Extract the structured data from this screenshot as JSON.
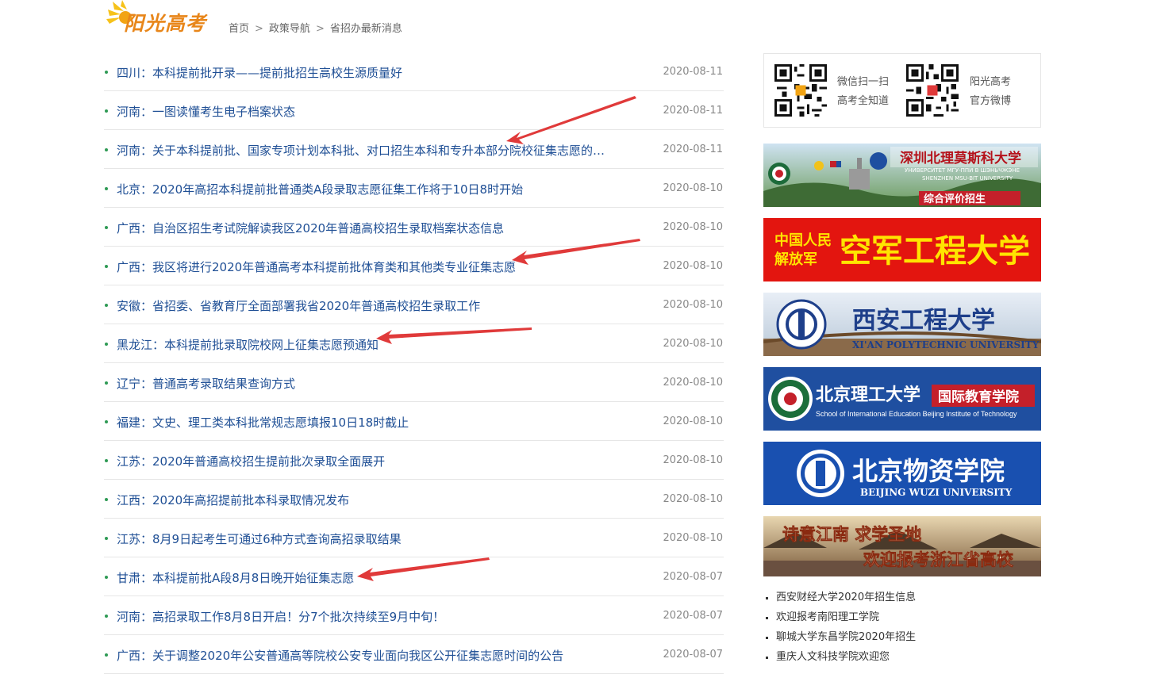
{
  "header": {
    "logo_text": "阳光高考",
    "breadcrumb": [
      "首页",
      "政策导航",
      "省招办最新消息"
    ],
    "breadcrumb_sep": ">"
  },
  "news": [
    {
      "title": "四川：本科提前批开录——提前批招生高校生源质量好",
      "date": "2020-08-11"
    },
    {
      "title": "河南：一图读懂考生电子档案状态",
      "date": "2020-08-11"
    },
    {
      "title": "河南：关于本科提前批、国家专项计划本科批、对口招生本科和专升本部分院校征集志愿的公告",
      "date": "2020-08-11"
    },
    {
      "title": "北京：2020年高招本科提前批普通类A段录取志愿征集工作将于10日8时开始",
      "date": "2020-08-10"
    },
    {
      "title": "广西：自治区招生考试院解读我区2020年普通高校招生录取档案状态信息",
      "date": "2020-08-10"
    },
    {
      "title": "广西：我区将进行2020年普通高考本科提前批体育类和其他类专业征集志愿",
      "date": "2020-08-10"
    },
    {
      "title": "安徽：省招委、省教育厅全面部署我省2020年普通高校招生录取工作",
      "date": "2020-08-10"
    },
    {
      "title": "黑龙江：本科提前批录取院校网上征集志愿预通知",
      "date": "2020-08-10"
    },
    {
      "title": "辽宁：普通高考录取结果查询方式",
      "date": "2020-08-10"
    },
    {
      "title": "福建：文史、理工类本科批常规志愿填报10日18时截止",
      "date": "2020-08-10"
    },
    {
      "title": "江苏：2020年普通高校招生提前批次录取全面展开",
      "date": "2020-08-10"
    },
    {
      "title": "江西：2020年高招提前批本科录取情况发布",
      "date": "2020-08-10"
    },
    {
      "title": "江苏：8月9日起考生可通过6种方式查询高招录取结果",
      "date": "2020-08-10"
    },
    {
      "title": "甘肃：本科提前批A段8月8日晚开始征集志愿",
      "date": "2020-08-07"
    },
    {
      "title": "河南：高招录取工作8月8日开启！分7个批次持续至9月中旬！",
      "date": "2020-08-07"
    },
    {
      "title": "广西：关于调整2020年公安普通高等院校公安专业面向我区公开征集志愿时间的公告",
      "date": "2020-08-07"
    }
  ],
  "sidebar": {
    "qr1_line1": "微信扫一扫",
    "qr1_line2": "高考全知道",
    "qr2_line1": "阳光高考",
    "qr2_line2": "官方微博",
    "banners": {
      "b1_title": "深圳北理莫斯科大学",
      "b1_sub": "УНИВЕРСИТЕТ МГУ-ППИ В ШЭНЬЧЖЭНЕ",
      "b1_sub2": "SHENZHEN MSU-BIT UNIVERSITY",
      "b1_tag": "综合评价招生",
      "b2_left1": "中国人民",
      "b2_left2": "解放军",
      "b2_right": "空军工程大学",
      "b3_title": "西安工程大学",
      "b3_sub": "XI'AN POLYTECHNIC UNIVERSITY",
      "b4_title": "北京理工大学",
      "b4_tag": "国际教育学院",
      "b4_sub": "School of International Education Beijing Institute of Technology",
      "b5_title": "北京物资学院",
      "b5_sub": "BEIJING WUZI UNIVERSITY",
      "b6_line1": "诗意江南  求学圣地",
      "b6_line2": "欢迎报考浙江省高校"
    },
    "links": [
      "西安财经大学2020年招生信息",
      "欢迎报考南阳理工学院",
      "聊城大学东昌学院2020年招生",
      "重庆人文科技学院欢迎您"
    ]
  },
  "colors": {
    "link": "#1f4f95",
    "bullet": "#2f9a55",
    "logo": "#e8861a",
    "arrow": "#e03a3a"
  }
}
